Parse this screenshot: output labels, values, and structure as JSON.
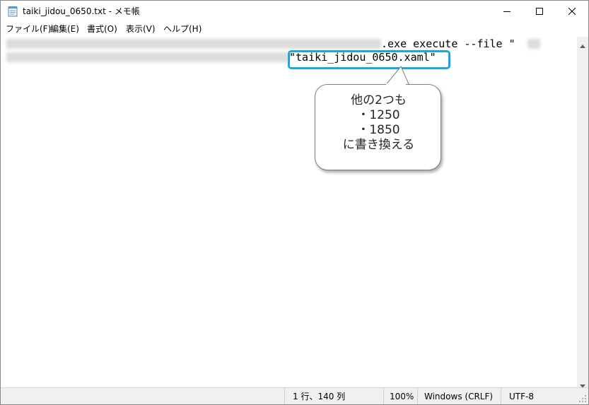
{
  "window": {
    "title": "taiki_jidou_0650.txt - メモ帳",
    "app_icon": "notepad-icon",
    "controls": [
      "minimize-icon",
      "maximize-icon",
      "close-icon"
    ]
  },
  "menu": {
    "file": "ファイル(F)",
    "edit": "編集(E)",
    "format": "書式(O)",
    "view": "表示(V)",
    "help": "ヘルプ(H)"
  },
  "editor": {
    "line1_visible": ".exe execute --file \"",
    "line2_visible": "\"taiki_jidou_0650.xaml\""
  },
  "annotation": {
    "callout_lines": [
      "他の2つも",
      "・1250",
      "・1850",
      "に書き換える"
    ],
    "highlight_color": "#1ba6e0"
  },
  "statusbar": {
    "position": "1 行、140 列",
    "zoom": "100%",
    "line_ending": "Windows (CRLF)",
    "encoding": "UTF-8"
  }
}
